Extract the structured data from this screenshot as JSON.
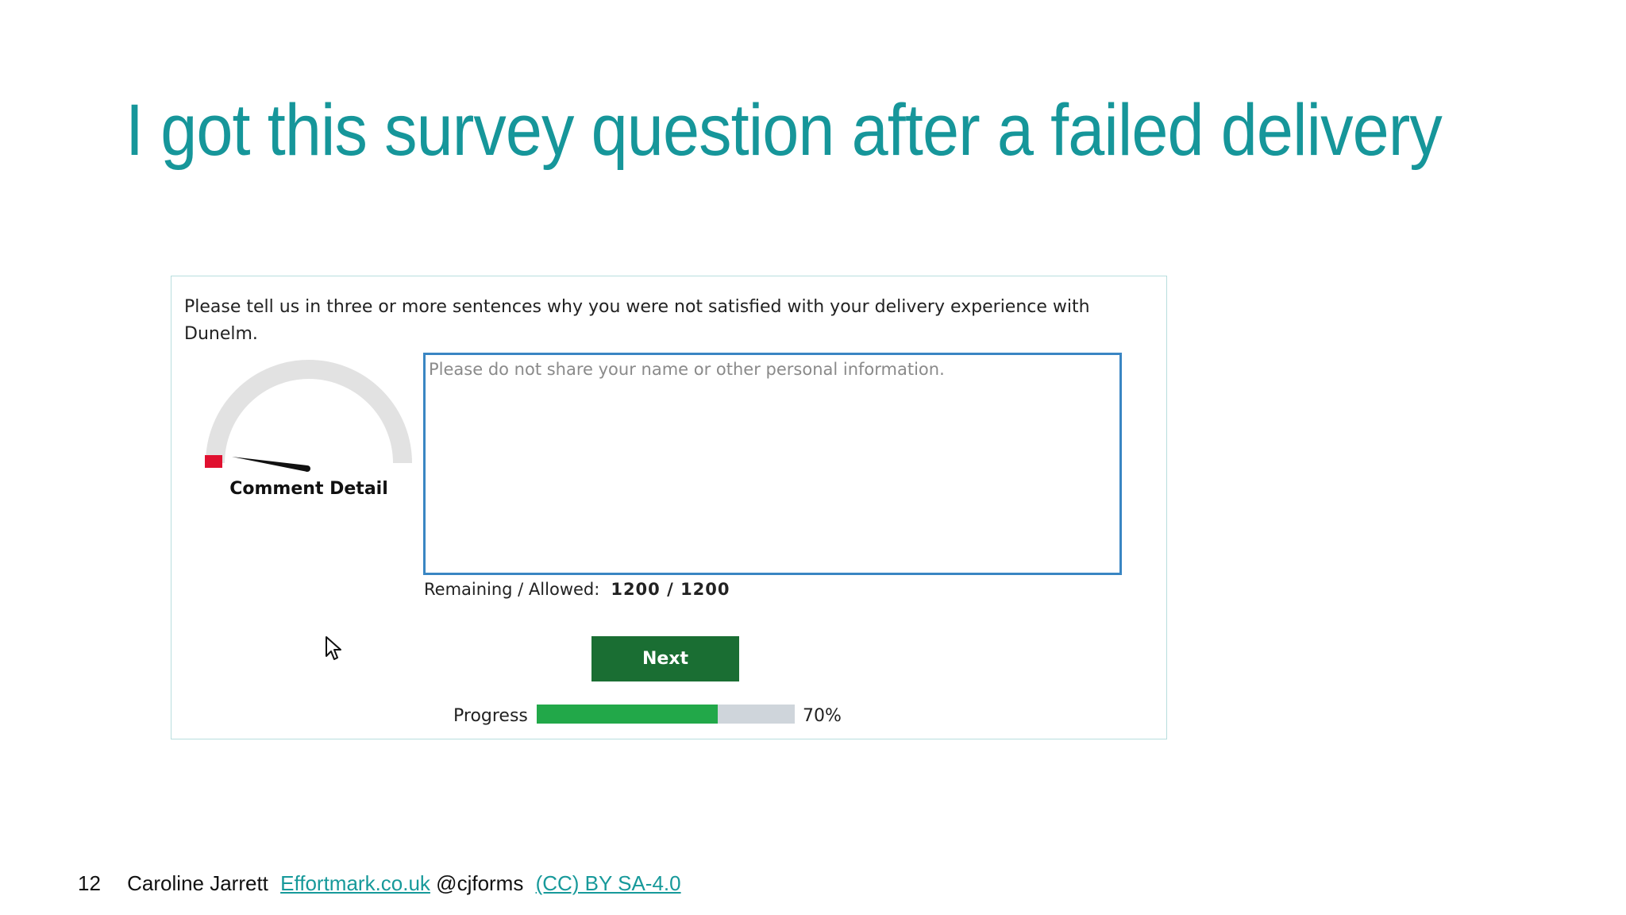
{
  "slide": {
    "title": "I got this survey question after a failed delivery",
    "title_color": "#16969a"
  },
  "survey": {
    "question": "Please tell us in three or more sentences why you were not satisfied with your delivery experience with Dunelm.",
    "gauge": {
      "label": "Comment Detail",
      "level": 0.0,
      "low_color": "#e0102f"
    },
    "comment": {
      "placeholder": "Please do not share your name or other personal information.",
      "value": ""
    },
    "counter": {
      "label": "Remaining / Allowed:",
      "value": "1200 / 1200"
    },
    "next_label": "Next",
    "progress": {
      "label": "Progress",
      "percent": 70,
      "percent_text": "70%",
      "fill_color": "#22a849"
    }
  },
  "footer": {
    "page_number": "12",
    "author": "Caroline Jarrett",
    "site_link": "Effortmark.co.uk",
    "handle": "@cjforms",
    "license_link": "(CC) BY SA-4.0"
  }
}
